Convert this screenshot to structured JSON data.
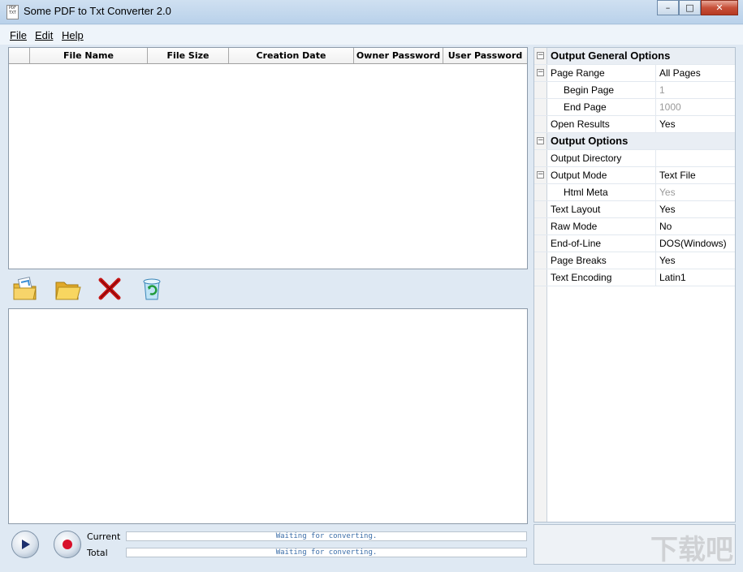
{
  "window": {
    "title": "Some PDF to Txt Converter 2.0",
    "icon_text": "PDF TXT",
    "controls": {
      "minimize": "–",
      "maximize": "□",
      "close": "✕"
    }
  },
  "menu": [
    {
      "label": "File"
    },
    {
      "label": "Edit"
    },
    {
      "label": "Help"
    }
  ],
  "file_table": {
    "columns": [
      "File Name",
      "File Size",
      "Creation Date",
      "Owner Password",
      "User Password"
    ],
    "rows": []
  },
  "toolbar": {
    "icons": [
      "add-files-icon",
      "open-folder-icon",
      "remove-file-icon",
      "clear-list-icon"
    ]
  },
  "progress": {
    "current_label": "Current",
    "total_label": "Total",
    "current_status": "Waiting for converting.",
    "total_status": "Waiting for converting."
  },
  "properties": {
    "general_title": "Output General Options",
    "page_range": {
      "label": "Page Range",
      "value": "All Pages"
    },
    "begin_page": {
      "label": "Begin Page",
      "value": "1"
    },
    "end_page": {
      "label": "End Page",
      "value": "1000"
    },
    "open_results": {
      "label": "Open Results",
      "value": "Yes"
    },
    "output_title": "Output Options",
    "output_directory": {
      "label": "Output Directory",
      "value": ""
    },
    "output_mode": {
      "label": "Output Mode",
      "value": "Text File"
    },
    "html_meta": {
      "label": "Html Meta",
      "value": "Yes"
    },
    "text_layout": {
      "label": "Text Layout",
      "value": "Yes"
    },
    "raw_mode": {
      "label": "Raw Mode",
      "value": "No"
    },
    "end_of_line": {
      "label": "End-of-Line",
      "value": "DOS(Windows)"
    },
    "page_breaks": {
      "label": "Page Breaks",
      "value": "Yes"
    },
    "text_encoding": {
      "label": "Text Encoding",
      "value": "Latin1"
    },
    "collapse_glyph": "−"
  },
  "watermark": "下载吧"
}
